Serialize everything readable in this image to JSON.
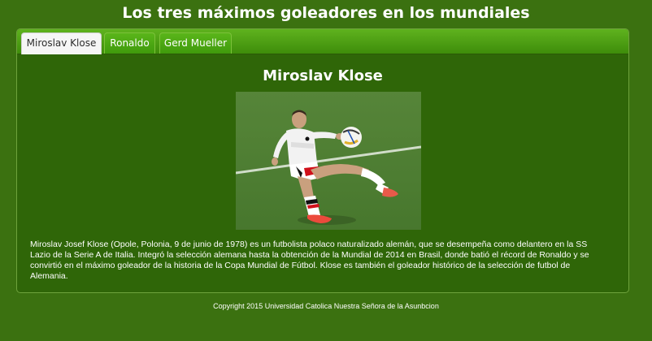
{
  "page": {
    "title": "Los tres máximos goleadores en los mundiales"
  },
  "tabs": [
    {
      "label": "Miroslav Klose",
      "active": true
    },
    {
      "label": "Ronaldo",
      "active": false
    },
    {
      "label": "Gerd Mueller",
      "active": false
    }
  ],
  "panel": {
    "heading": "Miroslav Klose",
    "photo": {
      "subject": "soccer player in white jersey controlling ball on pitch"
    },
    "bio": "Miroslav Josef Klose (Opole, Polonia, 9 de junio de 1978) es un futbolista polaco naturalizado alemán, que se desempeña como delantero en la SS Lazio de la Serie A de Italia. Integró la selección alemana hasta la obtención de la Mundial de 2014 en Brasil, donde batió el récord de Ronaldo y se convirtió en el máximo goleador de la historia de la Copa Mundial de Fútbol. Klose es también el goleador histórico de la selección de futbol de Alemania."
  },
  "footer": {
    "copyright": "Copyright 2015 Universidad Catolica Nuestra Señora de la Asunbcion"
  },
  "colors": {
    "page_background": "#3b7110",
    "panel_background": "#2f6608",
    "tab_bar": "#4fa012",
    "active_tab": "#f6f6f6"
  }
}
